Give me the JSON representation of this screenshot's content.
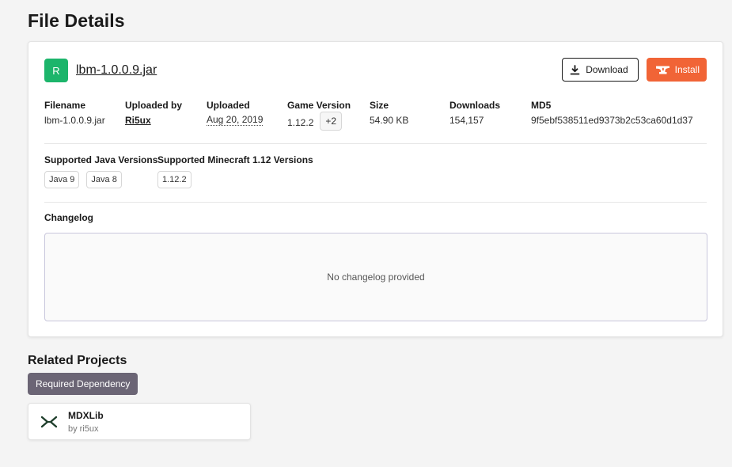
{
  "page": {
    "title": "File Details"
  },
  "file": {
    "release_badge": "R",
    "name": "lbm-1.0.0.9.jar",
    "actions": {
      "download_label": "Download",
      "install_label": "Install"
    },
    "meta": {
      "filename": {
        "label": "Filename",
        "value": "lbm-1.0.0.9.jar"
      },
      "uploaded_by": {
        "label": "Uploaded by",
        "value": "Ri5ux"
      },
      "uploaded": {
        "label": "Uploaded",
        "value": "Aug 20, 2019"
      },
      "game_version": {
        "label": "Game Version",
        "value": "1.12.2",
        "more": "+2"
      },
      "size": {
        "label": "Size",
        "value": "54.90 KB"
      },
      "downloads": {
        "label": "Downloads",
        "value": "154,157"
      },
      "md5": {
        "label": "MD5",
        "value": "9f5ebf538511ed9373b2c53ca60d1d37"
      }
    },
    "java_versions": {
      "label": "Supported Java Versions",
      "items": [
        "Java 9",
        "Java 8"
      ]
    },
    "minecraft_versions": {
      "label": "Supported Minecraft 1.12 Versions",
      "items": [
        "1.12.2"
      ]
    },
    "changelog": {
      "label": "Changelog",
      "empty_text": "No changelog provided"
    }
  },
  "related": {
    "title": "Related Projects",
    "dependency_label": "Required Dependency",
    "projects": [
      {
        "name": "MDXLib",
        "author": "by ri5ux"
      }
    ]
  },
  "colors": {
    "release_green": "#1cb56b",
    "install_orange": "#f16436",
    "dependency_badge": "#6b6575"
  },
  "icons": {
    "download": "download-icon",
    "install": "anvil-icon",
    "project": "mdxlib-logo-icon"
  }
}
